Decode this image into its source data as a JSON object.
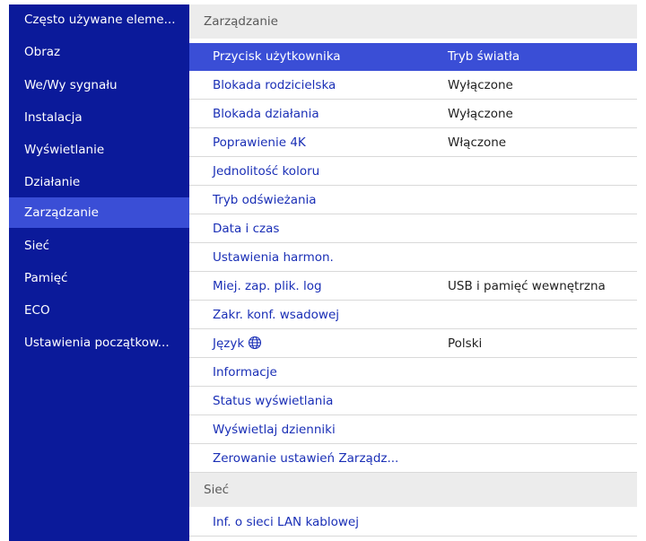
{
  "sidebar": {
    "items": [
      {
        "label": "Często używane eleme..."
      },
      {
        "label": "Obraz"
      },
      {
        "label": "We/Wy sygnału"
      },
      {
        "label": "Instalacja"
      },
      {
        "label": "Wyświetlanie"
      },
      {
        "label": "Działanie"
      },
      {
        "label": "Zarządzanie"
      },
      {
        "label": "Sieć"
      },
      {
        "label": "Pamięć"
      },
      {
        "label": "ECO"
      },
      {
        "label": "Ustawienia początkow..."
      }
    ],
    "active": "Zarządzanie"
  },
  "main": {
    "section_management": "Zarządzanie",
    "section_network": "Sieć",
    "rows": [
      {
        "label": "Przycisk użytkownika",
        "value": "Tryb światła"
      },
      {
        "label": "Blokada rodzicielska",
        "value": "Wyłączone"
      },
      {
        "label": "Blokada działania",
        "value": "Wyłączone"
      },
      {
        "label": "Poprawienie 4K",
        "value": "Włączone"
      },
      {
        "label": "Jednolitość koloru",
        "value": ""
      },
      {
        "label": "Tryb odświeżania",
        "value": ""
      },
      {
        "label": "Data i czas",
        "value": ""
      },
      {
        "label": "Ustawienia harmon.",
        "value": ""
      },
      {
        "label": "Miej. zap. plik. log",
        "value": "USB i pamięć wewnętrzna"
      },
      {
        "label": "Zakr. konf. wsadowej",
        "value": ""
      },
      {
        "label": "Język",
        "value": "Polski",
        "icon": "globe-icon"
      },
      {
        "label": "Informacje",
        "value": ""
      },
      {
        "label": "Status wyświetlania",
        "value": ""
      },
      {
        "label": "Wyświetlaj dzienniki",
        "value": ""
      },
      {
        "label": "Zerowanie ustawień Zarządz...",
        "value": ""
      }
    ],
    "network_rows": [
      {
        "label": "Inf. o sieci LAN kablowej"
      }
    ]
  },
  "colors": {
    "sidebar_bg": "#0b1a9a",
    "highlight": "#3a4ed6",
    "label_blue": "#1a2fb6",
    "header_gray": "#ececec"
  }
}
